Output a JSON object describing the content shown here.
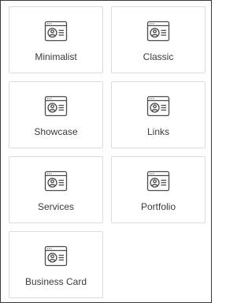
{
  "templates": [
    {
      "label": "Minimalist",
      "icon": "profile-card-icon"
    },
    {
      "label": "Classic",
      "icon": "profile-card-icon"
    },
    {
      "label": "Showcase",
      "icon": "profile-card-icon"
    },
    {
      "label": "Links",
      "icon": "profile-card-icon"
    },
    {
      "label": "Services",
      "icon": "profile-card-icon"
    },
    {
      "label": "Portfolio",
      "icon": "profile-card-icon"
    },
    {
      "label": "Business Card",
      "icon": "profile-card-icon"
    }
  ],
  "colors": {
    "border": "#dcdcdc",
    "icon": "#4a4a4a",
    "text": "#3b3b3b"
  }
}
